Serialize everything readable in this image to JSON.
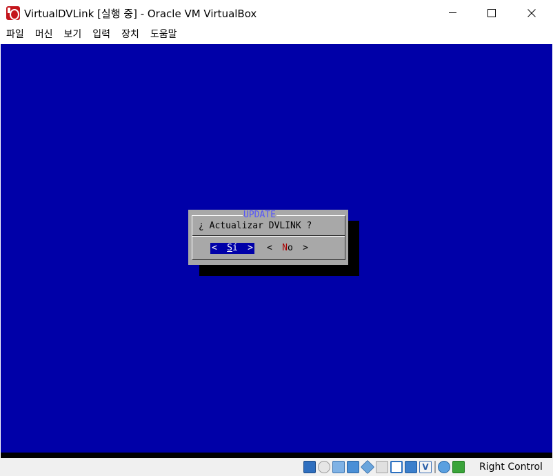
{
  "window": {
    "title": "VirtualDVLink [실행 중] - Oracle VM VirtualBox"
  },
  "menu": {
    "items": [
      "파일",
      "머신",
      "보기",
      "입력",
      "장치",
      "도움말"
    ]
  },
  "dialog": {
    "title": "UPDATE",
    "message": "¿ Actualizar DVLINK ?",
    "yes": {
      "left": "<",
      "hot": "S",
      "rest": "í",
      "right": ">"
    },
    "no": {
      "left": "<",
      "hot": "N",
      "rest": "o",
      "right": ">"
    }
  },
  "statusbar": {
    "v_icon_label": "V",
    "host_key": "Right Control"
  },
  "colors": {
    "vm_background": "#0000a8",
    "dialog_background": "#a8a8a8",
    "dialog_title": "#5454fc",
    "hotkey_red": "#a80000"
  }
}
